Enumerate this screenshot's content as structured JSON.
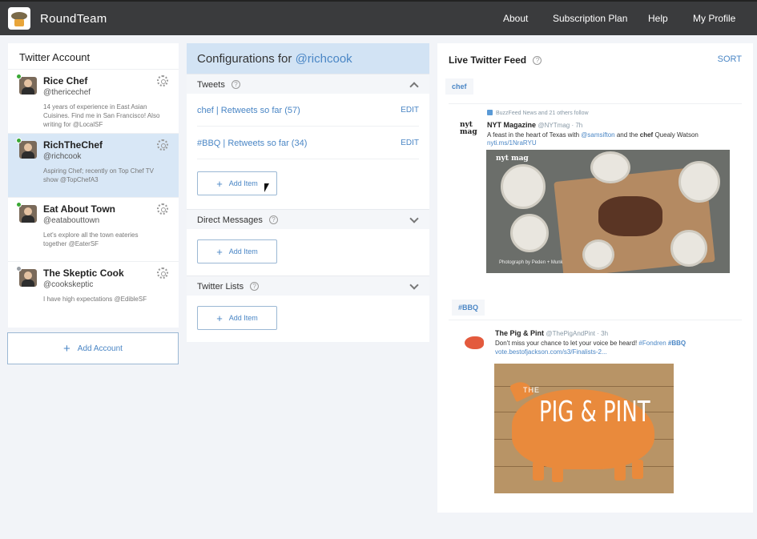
{
  "app": {
    "brand": "RoundTeam"
  },
  "nav": {
    "about": "About",
    "subscription": "Subscription Plan",
    "help": "Help",
    "profile": "My Profile"
  },
  "accounts_panel": {
    "title": "Twitter Account",
    "add_label": "Add Account",
    "accounts": [
      {
        "name": "Rice Chef",
        "handle": "@thericechef",
        "bio": "14 years of experience in East Asian Cuisines. Find me in San Francisco! Also writing for @LocalSF",
        "status": "online"
      },
      {
        "name": "RichTheChef",
        "handle": "@richcook",
        "bio": "Aspiring Chef; recently on Top Chef TV show @TopChefA3",
        "status": "online"
      },
      {
        "name": "Eat About Town",
        "handle": "@eatabouttown",
        "bio": "Let's explore all the town eateries together @EaterSF",
        "status": "online"
      },
      {
        "name": "The Skeptic Cook",
        "handle": "@cookskeptic",
        "bio": "I have high expectations @EdibleSF",
        "status": "offline"
      }
    ]
  },
  "config": {
    "title_prefix": "Configurations for ",
    "title_handle": "@richcook",
    "sections": {
      "tweets": {
        "label": "Tweets",
        "help": "?"
      },
      "dm": {
        "label": "Direct Messages",
        "help": "?"
      },
      "lists": {
        "label": "Twitter Lists",
        "help": "?"
      }
    },
    "tweet_items": [
      {
        "label": "chef | Retweets so far (57)",
        "edit": "EDIT"
      },
      {
        "label": "#BBQ | Retweets so far (34)",
        "edit": "EDIT"
      }
    ],
    "add_item_label": "Add Item"
  },
  "feed": {
    "title": "Live Twitter Feed",
    "help": "?",
    "sort_label": "SORT",
    "tag1": "chef",
    "tag2": "#BBQ",
    "tweet1": {
      "social": "BuzzFeed News and 21 others follow",
      "avatar_text": "nyt mag",
      "name": "NYT Magazine",
      "handle": "@NYTmag · 7h",
      "text_a": "A feast in the heart of Texas with ",
      "mention": "@samsifton",
      "text_b": " and the ",
      "bold": "chef",
      "text_c": " Quealy Watson",
      "link": "nyti.ms/1NraRYU",
      "photo_logo": "nyt mag",
      "photo_credit": "Photograph by Peden + Munk"
    },
    "tweet2": {
      "name": "The Pig & Pint",
      "handle": "@ThePigAndPint · 3h",
      "text_a": "Don't miss your chance to let your voice be heard! ",
      "tag_a": "#Fondren",
      "tag_b": "#BBQ",
      "link": "vote.bestofjackson.com/s3/Finalists-2...",
      "img_the": "THE",
      "img_title": "PIG & PINT"
    }
  },
  "colors": {
    "accent": "#4a86c5",
    "topbar": "#3a3b3d",
    "active": "#d8e7f6"
  }
}
